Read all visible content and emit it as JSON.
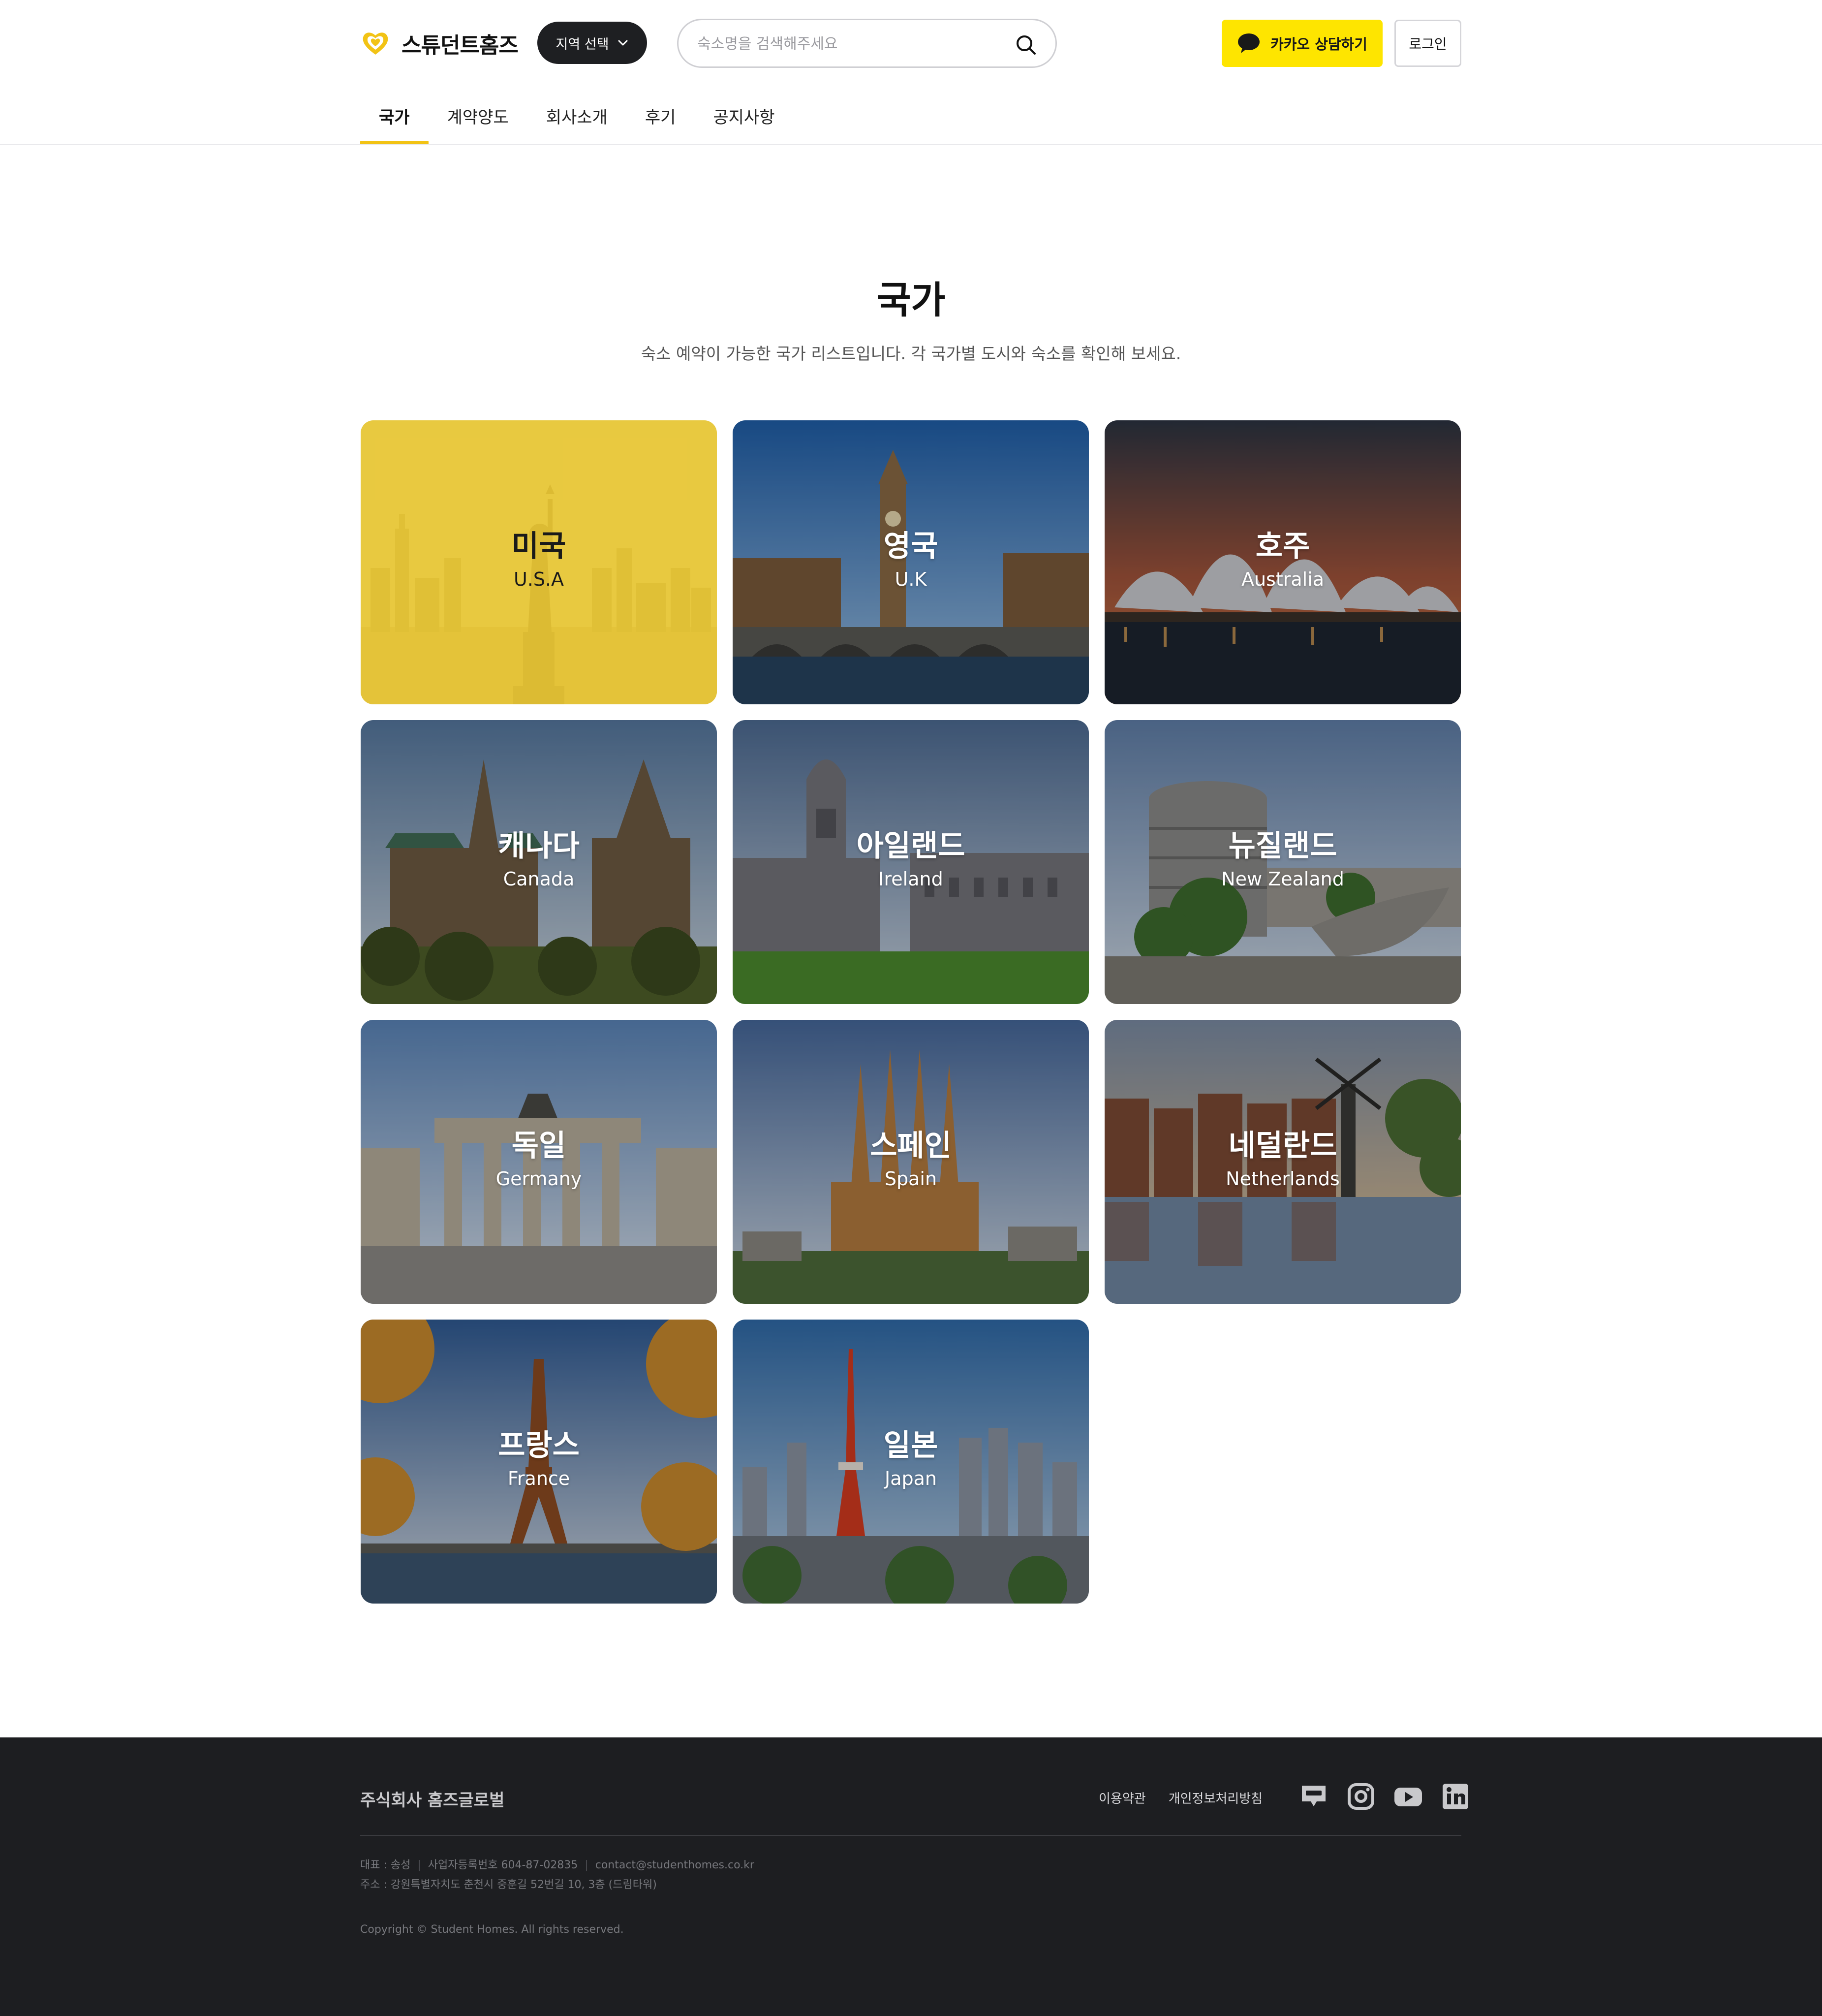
{
  "header": {
    "logo_text": "스튜던트홈즈",
    "region_button": "지역 선택",
    "search_placeholder": "숙소명을 검색해주세요",
    "kakao_button": "카카오 상담하기",
    "login_button": "로그인"
  },
  "nav": {
    "items": [
      {
        "label": "국가",
        "active": true
      },
      {
        "label": "계약양도"
      },
      {
        "label": "회사소개"
      },
      {
        "label": "후기"
      },
      {
        "label": "공지사항"
      }
    ]
  },
  "main": {
    "title": "국가",
    "subtitle": "숙소 예약이 가능한 국가 리스트입니다. 각 국가별 도시와 숙소를 확인해 보세요."
  },
  "countries": [
    {
      "ko": "미국",
      "en": "U.S.A"
    },
    {
      "ko": "영국",
      "en": "U.K"
    },
    {
      "ko": "호주",
      "en": "Australia"
    },
    {
      "ko": "캐나다",
      "en": "Canada"
    },
    {
      "ko": "아일랜드",
      "en": "Ireland"
    },
    {
      "ko": "뉴질랜드",
      "en": "New Zealand"
    },
    {
      "ko": "독일",
      "en": "Germany"
    },
    {
      "ko": "스페인",
      "en": "Spain"
    },
    {
      "ko": "네덜란드",
      "en": "Netherlands"
    },
    {
      "ko": "프랑스",
      "en": "France"
    },
    {
      "ko": "일본",
      "en": "Japan"
    }
  ],
  "footer": {
    "company": "주식회사 홈즈글로벌",
    "links": [
      "이용약관",
      "개인정보처리방침"
    ],
    "social_icons": [
      "blog-icon",
      "instagram-icon",
      "youtube-icon",
      "linkedin-icon"
    ],
    "ceo": "대표 : 송성",
    "biz_no": "사업자등록번호 604-87-02835",
    "email": "contact@studenthomes.co.kr",
    "address": "주소 :  강원특별자치도 춘천시 중훈길 52번길 10, 3층 (드림타워)",
    "copyright": "Copyright © Student Homes. All rights reserved."
  },
  "colors": {
    "accent": "#f2c315",
    "kakao": "#fee500",
    "footer_bg": "#1d1e21",
    "featured_overlay": "#e8c628"
  }
}
